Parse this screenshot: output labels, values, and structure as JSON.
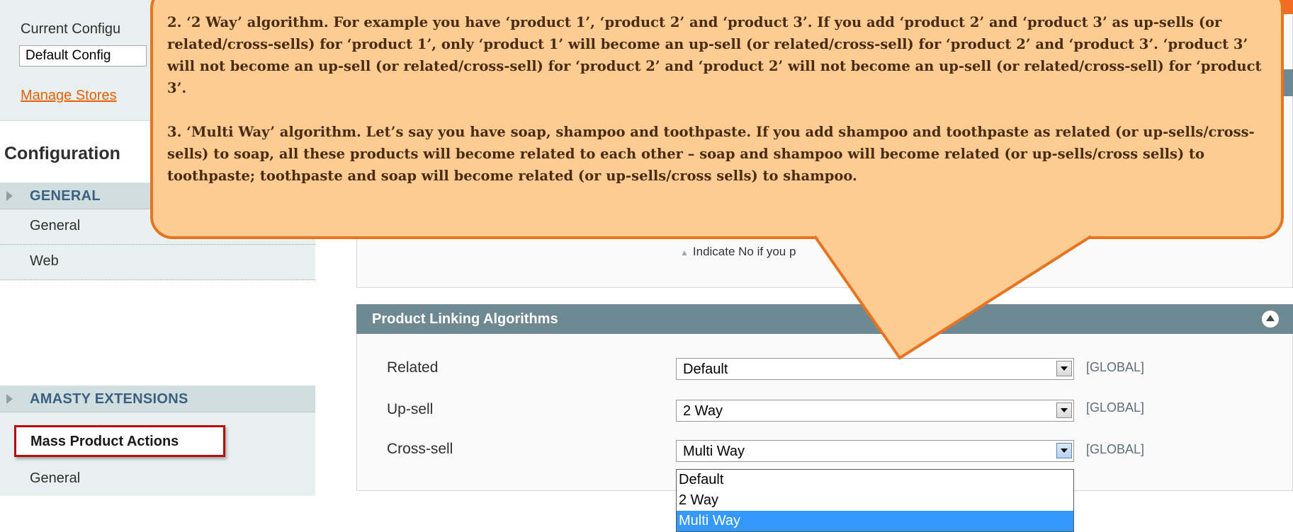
{
  "sidebar": {
    "scope_label": "Current Configu",
    "scope_value": "Default Config",
    "manage_stores": "Manage Stores",
    "heading": "Configuration",
    "groups": [
      {
        "title": "GENERAL",
        "items": [
          "General",
          "Web"
        ]
      },
      {
        "title": "AMASTY EXTENSIONS",
        "items": [
          "Mass Product Actions",
          "General"
        ]
      }
    ]
  },
  "main": {
    "hint": "Indicate No if you p",
    "section": {
      "title": "Product Linking Algorithms",
      "rows": [
        {
          "label": "Related",
          "value": "Default",
          "scope": "[GLOBAL]"
        },
        {
          "label": "Up-sell",
          "value": "2 Way",
          "scope": "[GLOBAL]"
        },
        {
          "label": "Cross-sell",
          "value": "Multi Way",
          "scope": "[GLOBAL]"
        }
      ],
      "dropdown_options": [
        "Default",
        "2 Way",
        "Multi Way"
      ],
      "dropdown_selected": "Multi Way"
    }
  },
  "callout": {
    "paragraph_1": "2. ‘2 Way’ algorithm. For example you have ‘product 1’, ‘product 2’ and ‘product 3’. If you add ‘product 2’ and ‘product 3’ as up-sells (or related/cross-sells) for ‘product 1’, only ‘product 1’ will become an up-sell (or related/cross-sell)  for ‘product 2’ and ‘product 3’. ‘product 3’ will not become an up-sell (or related/cross-sell) for ‘product 2’  and ‘product 2’ will not become an up-sell (or related/cross-sell)  for ‘product 3’.",
    "paragraph_2": "3. ‘Multi Way’ algorithm. Let’s say you have soap, shampoo and toothpaste. If you add shampoo and toothpaste as related (or up-sells/cross-sells) to soap, all these products will become related to each other – soap and shampoo will become related (or up-sells/cross sells) to toothpaste; toothpaste and soap will become related (or up-sells/cross sells) to  shampoo."
  },
  "colors": {
    "callout_fill": "#fccc93",
    "callout_border": "#e8741f",
    "section_header": "#6f8992",
    "link": "#eb5e00",
    "highlight_box": "#b20e0e",
    "selected_option": "#3399ff"
  }
}
